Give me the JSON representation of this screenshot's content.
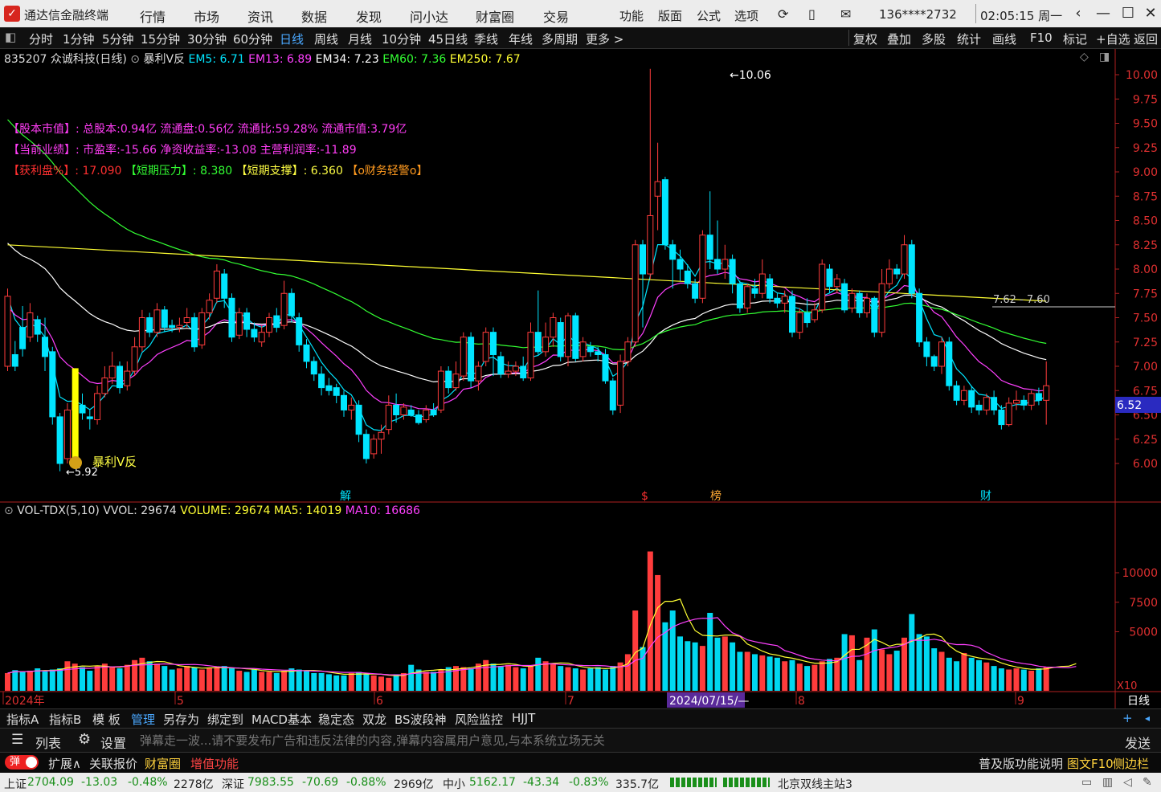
{
  "titlebar": {
    "app_name": "通达信金融终端",
    "menus": [
      "行情",
      "市场",
      "资讯",
      "数据",
      "发现",
      "问小达",
      "财富圈",
      "交易"
    ],
    "right_menus": [
      "功能",
      "版面",
      "公式",
      "选项"
    ],
    "account": "136****2732",
    "time": "02:05:15 周一"
  },
  "periods": [
    "分时",
    "1分钟",
    "5分钟",
    "15分钟",
    "30分钟",
    "60分钟",
    "日线",
    "周线",
    "月线",
    "10分钟",
    "45日线",
    "季线",
    "年线",
    "多周期",
    "更多 >"
  ],
  "active_period": "日线",
  "right_tools": [
    "复权",
    "叠加",
    "多股",
    "统计",
    "画线",
    "F10",
    "标记",
    "+自选",
    "返回"
  ],
  "stock": {
    "header": "835207 众诚科技(日线)",
    "indicator_name": "暴利V反",
    "ema": [
      {
        "label": "EM5: 6.71",
        "color": "#00e5ff"
      },
      {
        "label": "EM13: 6.89",
        "color": "#ff40ff"
      },
      {
        "label": "EM34: 7.23",
        "color": "#ffffff"
      },
      {
        "label": "EM60: 7.36",
        "color": "#33ff33"
      },
      {
        "label": "EM250: 7.67",
        "color": "#ffff33"
      }
    ],
    "info_line1": "【股本市值】: 总股本:0.94亿 流通盘:0.56亿 流通比:59.28% 流通市值:3.79亿",
    "info_line2": "【当前业绩】: 市盈率:-15.66 净资收益率:-13.08 主营利润率:-11.89",
    "info_line3a": "【获利盘%】: 17.090",
    "info_line3b": "【短期压力】: 8.380",
    "info_line3c": "【短期支撑】: 6.360",
    "info_line3d": "【o财务轻警o】",
    "high_label": "10.06",
    "low_label": "5.92",
    "signal_label": "暴利V反",
    "line_label": "7.62 - 7.60",
    "current_price": "6.52",
    "event_marks": [
      "解",
      "$",
      "榜",
      "财"
    ]
  },
  "volume": {
    "header": "VOL-TDX(5,10)",
    "vvol": "VVOL: 29674",
    "volume": "VOLUME: 29674",
    "ma5": "MA5: 14019",
    "ma10": "MA10: 16686",
    "axis_labels": [
      "10000",
      "7500",
      "5000"
    ],
    "unit": "X10"
  },
  "date_axis": {
    "labels": [
      "2024年",
      "5",
      "6",
      "7",
      "8",
      "9"
    ],
    "cursor_date": "2024/07/15/—",
    "period_tag": "日线"
  },
  "chart_data": {
    "type": "candlestick",
    "price_axis": [
      "10.00",
      "9.75",
      "9.50",
      "9.25",
      "9.00",
      "8.75",
      "8.50",
      "8.25",
      "8.00",
      "7.75",
      "7.50",
      "7.25",
      "7.00",
      "6.75",
      "6.50",
      "6.25",
      "6.00"
    ],
    "price_range": [
      5.85,
      10.15
    ],
    "candles": [
      [
        7.0,
        7.72,
        7.8,
        6.95
      ],
      [
        7.12,
        7.0,
        7.26,
        6.95
      ],
      [
        7.4,
        7.18,
        7.62,
        7.1
      ],
      [
        7.3,
        7.55,
        7.65,
        7.25
      ],
      [
        7.48,
        7.33,
        7.52,
        7.25
      ],
      [
        7.3,
        7.1,
        7.5,
        6.95
      ],
      [
        7.15,
        6.48,
        7.2,
        6.4
      ],
      [
        6.48,
        6.0,
        6.52,
        5.92
      ],
      [
        6.05,
        6.55,
        6.62,
        6.0
      ],
      [
        6.55,
        6.65,
        6.7,
        6.5
      ],
      [
        6.6,
        6.52,
        6.72,
        6.45
      ],
      [
        6.48,
        6.46,
        6.55,
        6.35
      ],
      [
        6.45,
        6.72,
        6.8,
        6.4
      ],
      [
        6.72,
        6.88,
        7.0,
        6.68
      ],
      [
        6.88,
        7.0,
        7.15,
        6.82
      ],
      [
        7.0,
        6.78,
        7.05,
        6.72
      ],
      [
        6.8,
        6.95,
        7.05,
        6.75
      ],
      [
        6.95,
        7.2,
        7.3,
        6.9
      ],
      [
        7.2,
        7.5,
        7.58,
        7.15
      ],
      [
        7.5,
        7.35,
        7.55,
        7.3
      ],
      [
        7.35,
        7.58,
        7.65,
        7.3
      ],
      [
        7.58,
        7.4,
        7.62,
        7.35
      ],
      [
        7.42,
        7.4,
        7.48,
        7.35
      ],
      [
        7.4,
        7.42,
        7.5,
        7.35
      ],
      [
        7.45,
        7.5,
        7.6,
        7.4
      ],
      [
        7.5,
        7.2,
        7.55,
        7.15
      ],
      [
        7.22,
        7.55,
        7.6,
        7.18
      ],
      [
        7.55,
        7.68,
        7.75,
        7.48
      ],
      [
        7.7,
        7.98,
        8.05,
        7.65
      ],
      [
        7.95,
        7.7,
        8.0,
        7.6
      ],
      [
        7.7,
        7.3,
        7.75,
        7.25
      ],
      [
        7.32,
        7.55,
        7.6,
        7.28
      ],
      [
        7.55,
        7.38,
        7.6,
        7.3
      ],
      [
        7.38,
        7.3,
        7.45,
        7.25
      ],
      [
        7.25,
        7.35,
        7.42,
        7.2
      ],
      [
        7.35,
        7.5,
        7.55,
        7.3
      ],
      [
        7.52,
        7.4,
        7.6,
        7.35
      ],
      [
        7.42,
        7.75,
        7.88,
        7.38
      ],
      [
        7.75,
        7.52,
        7.8,
        7.45
      ],
      [
        7.5,
        7.22,
        7.55,
        7.15
      ],
      [
        7.22,
        7.05,
        7.28,
        6.98
      ],
      [
        7.05,
        6.92,
        7.1,
        6.85
      ],
      [
        6.92,
        6.78,
        7.0,
        6.7
      ],
      [
        6.8,
        6.75,
        6.88,
        6.7
      ],
      [
        6.78,
        6.7,
        6.82,
        6.62
      ],
      [
        6.7,
        6.55,
        6.75,
        6.48
      ],
      [
        6.55,
        6.6,
        6.68,
        6.45
      ],
      [
        6.6,
        6.3,
        6.65,
        6.22
      ],
      [
        6.3,
        6.05,
        6.35,
        6.0
      ],
      [
        6.1,
        6.25,
        6.3,
        6.05
      ],
      [
        6.25,
        6.32,
        6.4,
        6.1
      ],
      [
        6.35,
        6.6,
        6.7,
        6.3
      ],
      [
        6.6,
        6.5,
        6.72,
        6.42
      ],
      [
        6.5,
        6.58,
        6.62,
        6.45
      ],
      [
        6.55,
        6.5,
        6.6,
        6.48
      ],
      [
        6.5,
        6.42,
        6.55,
        6.4
      ],
      [
        6.45,
        6.55,
        6.6,
        6.42
      ],
      [
        6.55,
        6.5,
        6.62,
        6.48
      ],
      [
        6.55,
        6.95,
        7.0,
        6.52
      ],
      [
        6.95,
        6.78,
        7.0,
        6.72
      ],
      [
        6.78,
        6.92,
        7.05,
        6.75
      ],
      [
        6.9,
        7.3,
        7.35,
        6.85
      ],
      [
        7.3,
        6.85,
        7.35,
        6.78
      ],
      [
        6.85,
        7.0,
        7.05,
        6.75
      ],
      [
        7.05,
        7.35,
        7.4,
        7.0
      ],
      [
        7.35,
        7.12,
        7.4,
        6.9
      ],
      [
        7.1,
        6.92,
        7.15,
        6.88
      ],
      [
        6.92,
        6.95,
        7.05,
        6.88
      ],
      [
        6.95,
        7.0,
        7.05,
        6.9
      ],
      [
        7.0,
        6.88,
        7.1,
        6.85
      ],
      [
        6.88,
        7.35,
        7.45,
        6.85
      ],
      [
        7.35,
        7.15,
        7.78,
        7.12
      ],
      [
        7.15,
        7.3,
        7.45,
        7.1
      ],
      [
        7.3,
        7.5,
        7.55,
        7.2
      ],
      [
        7.45,
        7.1,
        7.5,
        7.05
      ],
      [
        7.1,
        7.52,
        7.55,
        7.0
      ],
      [
        7.52,
        7.08,
        7.55,
        7.05
      ],
      [
        7.1,
        7.25,
        7.3,
        7.05
      ],
      [
        7.2,
        7.15,
        7.25,
        7.1
      ],
      [
        7.15,
        7.12,
        7.2,
        7.05
      ],
      [
        7.12,
        6.85,
        7.18,
        6.82
      ],
      [
        6.85,
        6.55,
        6.88,
        6.5
      ],
      [
        6.6,
        7.05,
        7.12,
        6.52
      ],
      [
        7.05,
        7.25,
        7.3,
        7.0
      ],
      [
        7.25,
        8.25,
        8.3,
        7.2
      ],
      [
        8.25,
        7.95,
        8.3,
        7.4
      ],
      [
        7.95,
        8.55,
        10.06,
        7.9
      ],
      [
        8.75,
        8.9,
        9.3,
        8.4
      ],
      [
        8.92,
        8.25,
        8.95,
        8.2
      ],
      [
        8.25,
        8.1,
        8.3,
        7.8
      ],
      [
        8.1,
        8.0,
        8.2,
        7.88
      ],
      [
        7.98,
        7.85,
        8.05,
        7.8
      ],
      [
        7.85,
        7.7,
        7.9,
        7.65
      ],
      [
        7.7,
        8.35,
        8.4,
        7.65
      ],
      [
        8.35,
        8.1,
        8.8,
        8.0
      ],
      [
        8.1,
        8.0,
        8.5,
        7.95
      ],
      [
        8.0,
        8.1,
        8.25,
        7.9
      ],
      [
        8.1,
        7.85,
        8.15,
        7.75
      ],
      [
        7.85,
        7.6,
        7.88,
        7.55
      ],
      [
        7.6,
        7.82,
        7.85,
        7.55
      ],
      [
        7.8,
        7.75,
        7.9,
        7.7
      ],
      [
        7.75,
        7.95,
        8.1,
        7.7
      ],
      [
        7.9,
        7.7,
        7.95,
        7.65
      ],
      [
        7.7,
        7.65,
        7.75,
        7.6
      ],
      [
        7.65,
        7.72,
        7.78,
        7.55
      ],
      [
        7.72,
        7.35,
        7.78,
        7.3
      ],
      [
        7.35,
        7.55,
        7.6,
        7.28
      ],
      [
        7.55,
        7.45,
        7.7,
        7.4
      ],
      [
        7.48,
        7.58,
        7.65,
        7.45
      ],
      [
        7.58,
        8.05,
        8.1,
        7.55
      ],
      [
        8.0,
        7.82,
        8.05,
        7.75
      ],
      [
        7.82,
        7.9,
        7.95,
        7.75
      ],
      [
        7.85,
        7.58,
        7.9,
        7.55
      ],
      [
        7.6,
        7.75,
        7.8,
        7.55
      ],
      [
        7.75,
        7.55,
        7.78,
        7.5
      ],
      [
        7.55,
        7.7,
        7.75,
        7.5
      ],
      [
        7.7,
        7.35,
        7.72,
        7.3
      ],
      [
        7.35,
        7.85,
        8.0,
        7.3
      ],
      [
        7.85,
        8.0,
        8.1,
        7.8
      ],
      [
        8.0,
        7.95,
        8.05,
        7.9
      ],
      [
        7.95,
        8.25,
        8.35,
        7.9
      ],
      [
        8.25,
        7.75,
        8.3,
        7.7
      ],
      [
        7.75,
        7.25,
        7.8,
        7.2
      ],
      [
        7.25,
        7.1,
        7.3,
        7.0
      ],
      [
        7.1,
        7.0,
        7.12,
        6.95
      ],
      [
        7.0,
        7.25,
        7.3,
        6.92
      ],
      [
        7.25,
        6.8,
        7.3,
        6.75
      ],
      [
        6.8,
        6.65,
        6.85,
        6.6
      ],
      [
        6.65,
        6.75,
        6.8,
        6.6
      ],
      [
        6.75,
        6.58,
        6.8,
        6.52
      ],
      [
        6.6,
        6.55,
        6.65,
        6.5
      ],
      [
        6.55,
        6.68,
        6.72,
        6.5
      ],
      [
        6.68,
        6.55,
        6.75,
        6.5
      ],
      [
        6.55,
        6.4,
        6.6,
        6.35
      ],
      [
        6.4,
        6.62,
        6.68,
        6.38
      ],
      [
        6.62,
        6.65,
        6.75,
        6.55
      ],
      [
        6.65,
        6.6,
        6.7,
        6.55
      ],
      [
        6.6,
        6.72,
        6.75,
        6.55
      ],
      [
        6.72,
        6.65,
        6.78,
        6.6
      ],
      [
        6.65,
        6.8,
        7.05,
        6.4
      ]
    ],
    "volumes": [
      1500,
      1750,
      1600,
      1700,
      1900,
      1650,
      1800,
      1900,
      2500,
      2300,
      2000,
      1700,
      2100,
      2300,
      2000,
      1900,
      2200,
      2600,
      2800,
      2500,
      2300,
      2100,
      1800,
      1900,
      2100,
      2000,
      1800,
      1900,
      2000,
      2100,
      1900,
      1700,
      1600,
      1800,
      1600,
      1600,
      1500,
      1700,
      1900,
      1800,
      1700,
      1500,
      1500,
      1400,
      1300,
      1300,
      1500,
      1600,
      1400,
      1300,
      1200,
      1100,
      1400,
      1500,
      2200,
      1800,
      1600,
      1600,
      1800,
      2000,
      2100,
      2000,
      1900,
      2300,
      2600,
      2300,
      2100,
      2200,
      2000,
      1900,
      2100,
      2800,
      2500,
      2300,
      2100,
      2000,
      1900,
      1800,
      1900,
      2000,
      1800,
      2100,
      2400,
      3100,
      6800,
      3700,
      11800,
      9800,
      5800,
      6800,
      4600,
      4200,
      4100,
      3800,
      6600,
      4500,
      4600,
      4100,
      3300,
      3300,
      3100,
      3000,
      2900,
      2800,
      2500,
      2600,
      2300,
      2100,
      2200,
      2500,
      2700,
      2800,
      4800,
      4700,
      2600,
      4500,
      5200,
      3500,
      3100,
      3400,
      4500,
      6500,
      4800,
      4600,
      3600,
      3300,
      2800,
      2500,
      3200,
      2800,
      2600,
      2400,
      2100,
      1900,
      1800,
      1900,
      1800,
      1700,
      1900,
      2000,
      2500,
      2200,
      1800,
      3000
    ],
    "x_labels": [
      "2024年",
      "5",
      "6",
      "7",
      "8",
      "9"
    ],
    "volume_axis": [
      10000,
      7500,
      5000
    ]
  },
  "bottom_tabs": [
    "指标A",
    "指标B",
    "模 板",
    "管理",
    "另存为",
    "绑定到",
    "MACD基本",
    "稳定态",
    "双龙",
    "BS波段神",
    "风险监控",
    "HJJT"
  ],
  "active_bottom_tab": "管理",
  "list_button": "列表",
  "settings_button": "设置",
  "chat_placeholder": "弹幕走一波...请不要发布广告和违反法律的内容,弹幕内容属用户意见,与本系统立场无关",
  "send_button": "发送",
  "toolbar3": {
    "danmu": "弹",
    "expand": "扩展∧",
    "quote": "关联报价",
    "wealth": "财富圈",
    "value_add": "增值功能",
    "right": "普及版功能说明",
    "f10": "图文F10",
    "sidebar": "侧边栏"
  },
  "statusbar": {
    "sh": {
      "name": "上证",
      "value": "2704.09",
      "change": "-13.03",
      "pct": "-0.48%",
      "amount": "2278亿"
    },
    "sz": {
      "name": "深证",
      "value": "7983.55",
      "change": "-70.69",
      "pct": "-0.88%",
      "amount": "2969亿"
    },
    "zx": {
      "name": "中小",
      "value": "5162.17",
      "change": "-43.34",
      "pct": "-0.83%",
      "amount": "335.7亿"
    },
    "server": "北京双线主站3"
  }
}
